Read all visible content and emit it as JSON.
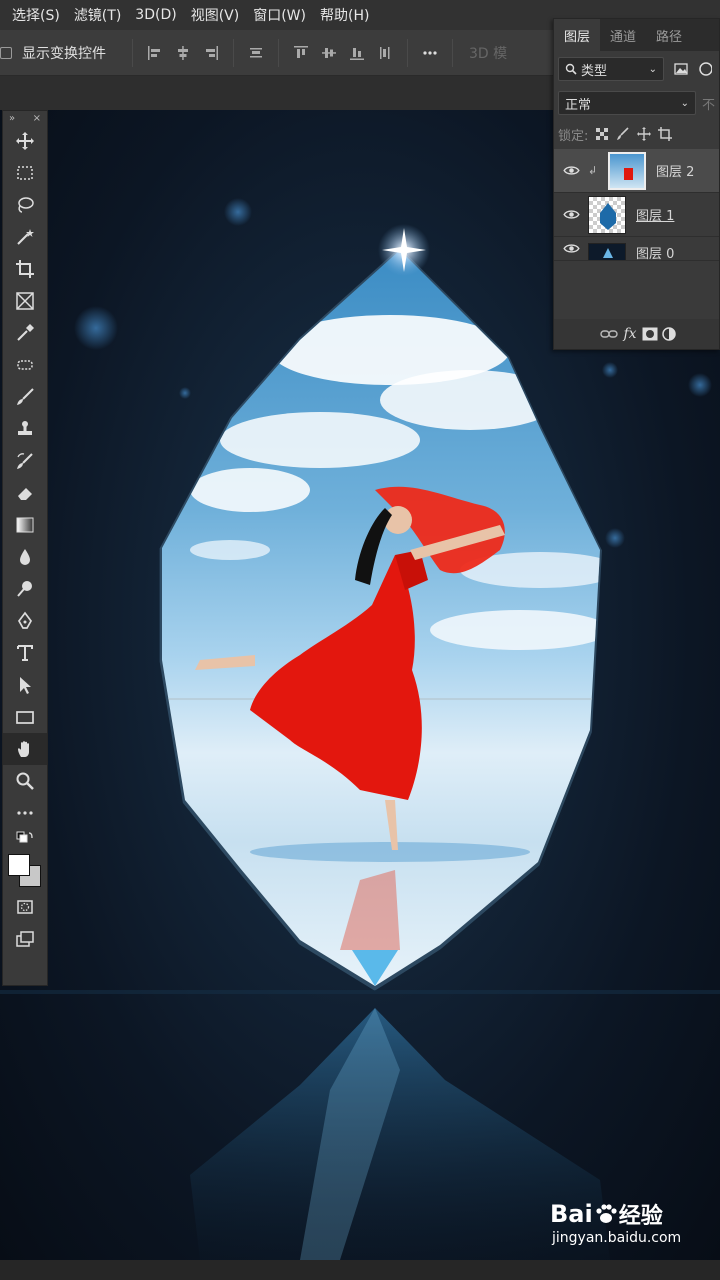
{
  "menu": {
    "items": [
      "选择(S)",
      "滤镜(T)",
      "3D(D)",
      "视图(V)",
      "窗口(W)",
      "帮助(H)"
    ]
  },
  "options_bar": {
    "show_transform_label": "显示变换控件",
    "more_icon": "ellipsis-icon",
    "mode_3d_label": "3D 模"
  },
  "toolbar": {
    "collapse_glyph": "»",
    "close_glyph": "×",
    "tools": [
      "move-tool-icon",
      "marquee-tool-icon",
      "lasso-tool-icon",
      "magic-wand-tool-icon",
      "crop-tool-icon",
      "frame-tool-icon",
      "eyedropper-tool-icon",
      "spot-healing-tool-icon",
      "brush-tool-icon",
      "clone-stamp-tool-icon",
      "history-brush-tool-icon",
      "eraser-tool-icon",
      "gradient-tool-icon",
      "blur-tool-icon",
      "dodge-tool-icon",
      "pen-tool-icon",
      "type-tool-icon",
      "path-selection-tool-icon",
      "rectangle-tool-icon",
      "hand-tool-icon",
      "zoom-tool-icon",
      "more-tools-icon"
    ],
    "active_tool": "hand-tool-icon",
    "foreground_color": "#ffffff",
    "background_color": "#c8c8c8"
  },
  "layers_panel": {
    "tabs": [
      "图层",
      "通道",
      "路径"
    ],
    "active_tab": "图层",
    "filter_label": "类型",
    "blend_mode": "正常",
    "opacity_label_partial": "不",
    "lock_label": "锁定:",
    "layers": [
      {
        "name": "图层 2",
        "selected": true,
        "clipped": true
      },
      {
        "name": "图层 1",
        "selected": false,
        "clipped": false
      },
      {
        "name": "图层 0",
        "selected": false,
        "clipped": false
      }
    ]
  },
  "watermark": {
    "brand_left": "Bai",
    "brand_right": "经验",
    "url": "jingyan.baidu.com"
  }
}
